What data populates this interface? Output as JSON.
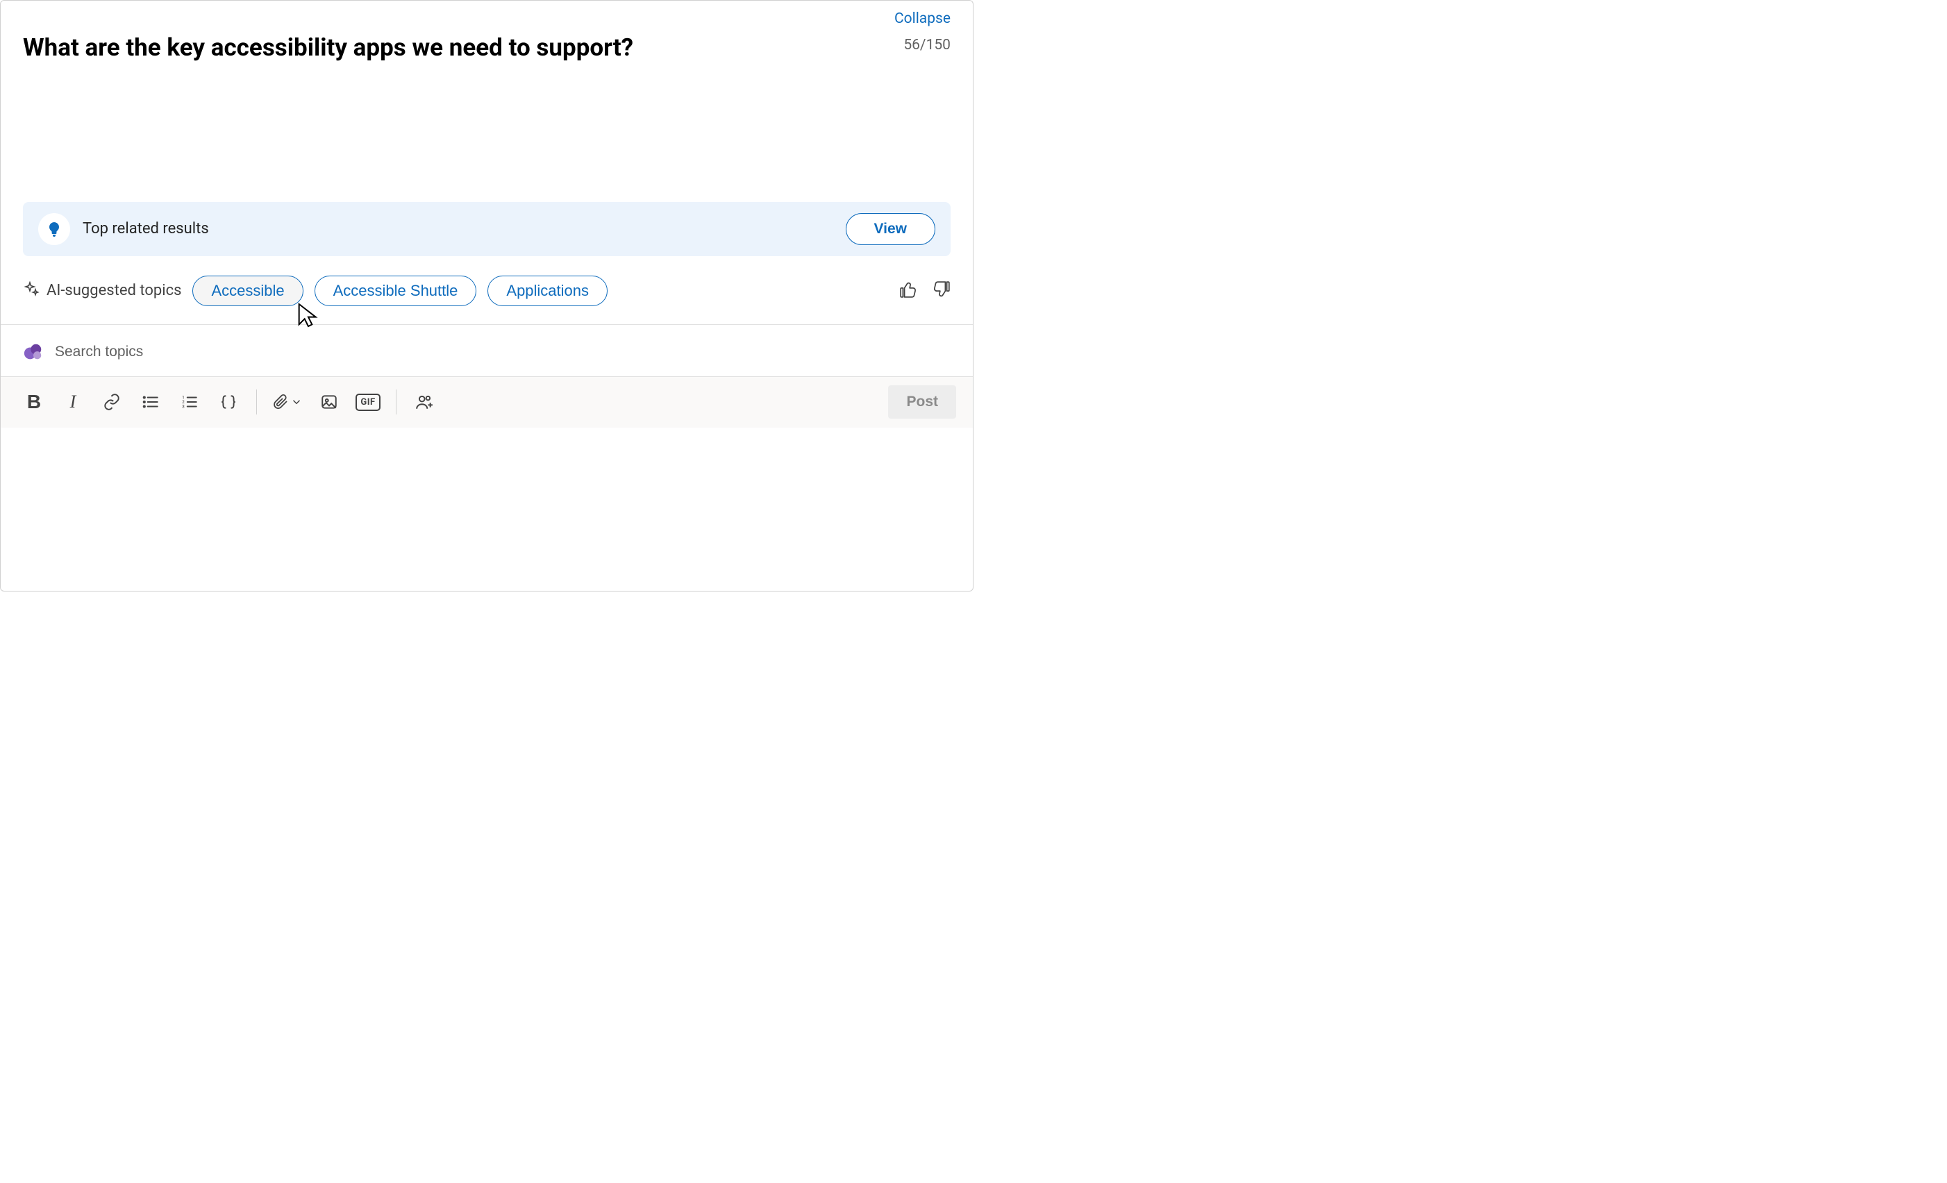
{
  "header": {
    "collapse_label": "Collapse",
    "char_count": "56/150",
    "title": "What are the key accessibility apps we need to support?"
  },
  "related": {
    "label": "Top related results",
    "view_label": "View"
  },
  "ai": {
    "label": "AI-suggested topics",
    "topics": [
      "Accessible",
      "Accessible Shuttle",
      "Applications"
    ]
  },
  "search": {
    "placeholder": "Search topics"
  },
  "toolbar": {
    "bold": "B",
    "italic": "I",
    "gif": "GIF",
    "post_label": "Post"
  }
}
